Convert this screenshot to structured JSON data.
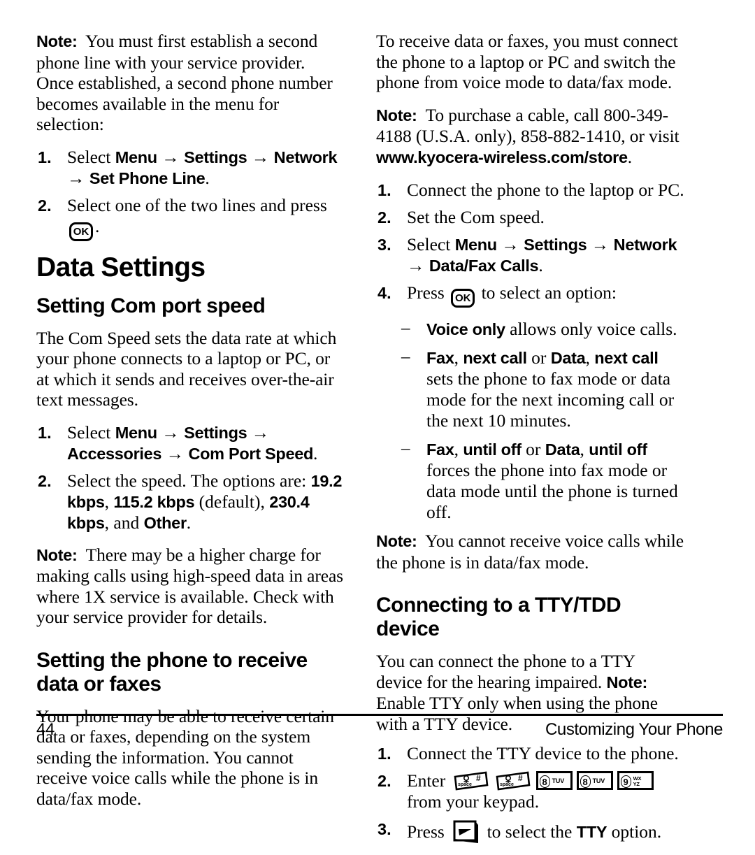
{
  "left_column": {
    "note_1": {
      "lead": "Note:",
      "text": "You must first establish a second phone line with your service provider. Once established, a second phone number becomes available in the menu for selection:"
    },
    "steps_1": [
      {
        "num": "1.",
        "prefix": "Select ",
        "path": [
          "Menu",
          "Settings",
          "Network",
          "Set Phone Line"
        ],
        "suffix": "."
      },
      {
        "num": "2.",
        "prefix": "Select one of the two lines and press ",
        "key": "ok-key",
        "suffix": "."
      }
    ],
    "chapter_heading": "Data Settings",
    "section_1_heading": "Setting Com port speed",
    "paragraph_1": "The Com Speed sets the data rate at which your phone connects to a laptop or PC, or at which it sends and receives over-the-air text messages.",
    "steps_2": [
      {
        "num": "1.",
        "prefix": "Select ",
        "path": [
          "Menu",
          "Settings",
          "Accessories",
          "Com Port Speed"
        ],
        "suffix": "."
      },
      {
        "num": "2.",
        "text_a": "Select the speed. The options are: ",
        "opt_1": "19.2 kbps",
        "sep_1": ", ",
        "opt_2": "115.2 kbps",
        "sep_2": " (default), ",
        "opt_3": "230.4 kbps",
        "sep_3": ", and ",
        "opt_4": "Other",
        "suffix": "."
      }
    ],
    "note_2": {
      "lead": "Note:",
      "text": "There may be a higher charge for making calls using high-speed data in areas where 1X service is available. Check with your service provider for details."
    },
    "section_2_heading": "Setting the phone to receive data or faxes",
    "paragraph_2": "Your phone may be able to receive certain data or faxes, depending on the system sending the information. You cannot receive voice calls while the phone is in data/fax mode."
  },
  "right_column": {
    "paragraph_1": "To receive data or faxes, you must connect the phone to a laptop or PC and switch the phone from voice mode to data/fax mode.",
    "note_1": {
      "lead": "Note:",
      "text_a": "To purchase a cable, call 800-349-4188 (U.S.A. only), 858-882-1410, or visit ",
      "site": "www.kyocera-wireless.com/store",
      "suffix": "."
    },
    "steps_1": [
      {
        "num": "1.",
        "text": "Connect the phone to the laptop or PC."
      },
      {
        "num": "2.",
        "text": "Set the Com speed."
      },
      {
        "num": "3.",
        "prefix": "Select ",
        "path": [
          "Menu",
          "Settings",
          "Network",
          "Data/Fax Calls"
        ],
        "suffix": "."
      },
      {
        "num": "4.",
        "prefix": "Press ",
        "key": "ok-key",
        "suffix": " to select an option:"
      }
    ],
    "options": [
      {
        "bold_1": "Voice only",
        "text_1": " allows only voice calls."
      },
      {
        "bold_1": "Fax",
        "mid_1": ", ",
        "bold_2": "next call",
        "joiner": " or ",
        "bold_3": "Data",
        "mid_2": ", ",
        "bold_4": "next call",
        "tail": " sets the phone to fax mode or data mode for the next incoming call or the next 10 minutes."
      },
      {
        "bold_1": "Fax",
        "mid_1": ", ",
        "bold_2": "until off",
        "joiner": " or ",
        "bold_3": "Data",
        "mid_2": ", ",
        "bold_4": "until off",
        "tail": " forces the phone into fax mode or data mode until the phone is turned off."
      }
    ],
    "note_2": {
      "lead": "Note:",
      "text": "You cannot receive voice calls while the phone is in data/fax mode."
    },
    "section_heading": "Connecting to a TTY/TDD device",
    "paragraph_2": {
      "text_a": "You can connect the phone to a TTY device for the hearing impaired. ",
      "note_lead": "Note:",
      "text_b": " Enable TTY only when using the phone with a TTY device."
    },
    "steps_2": [
      {
        "num": "1.",
        "text": "Connect the TTY device to the phone."
      },
      {
        "num": "2.",
        "prefix": "Enter ",
        "keys": [
          "space-hash-key",
          "space-hash-key",
          "eight-tuv-key",
          "eight-tuv-key",
          "nine-wxyz-key"
        ],
        "suffix": " from your keypad."
      },
      {
        "num": "3.",
        "prefix": "Press ",
        "key": "soft-key",
        "mid": " to select the ",
        "bold": "TTY",
        "suffix": " option."
      }
    ]
  },
  "keys": {
    "ok_label": "OK",
    "space_label": "space",
    "hash_label": "#",
    "eight_digit": "8",
    "eight_letters": "TUV",
    "nine_digit": "9",
    "nine_letters_top": "WX",
    "nine_letters_bottom": "YZ"
  },
  "footer": {
    "page_number": "44",
    "running_head": "Customizing Your Phone"
  }
}
